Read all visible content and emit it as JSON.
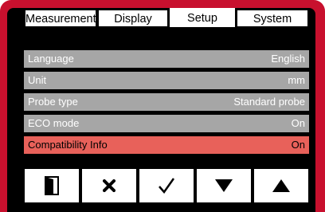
{
  "tabs": [
    {
      "label": "Measurement",
      "active": false
    },
    {
      "label": "Display",
      "active": false
    },
    {
      "label": "Setup",
      "active": true
    },
    {
      "label": "System",
      "active": false
    }
  ],
  "settings": [
    {
      "label": "Language",
      "value": "English"
    },
    {
      "label": "Unit",
      "value": "mm"
    },
    {
      "label": "Probe type",
      "value": "Standard probe"
    },
    {
      "label": "ECO mode",
      "value": "On"
    },
    {
      "label": "Compatibility Info",
      "value": "On",
      "selected": true
    }
  ],
  "softkeys": [
    {
      "icon": "exit-door-icon"
    },
    {
      "icon": "cancel-x-icon"
    },
    {
      "icon": "confirm-check-icon"
    },
    {
      "icon": "arrow-down-icon"
    },
    {
      "icon": "arrow-up-icon"
    }
  ],
  "colors": {
    "housing": "#c8102e",
    "screen": "#000000",
    "row_background": "#a6a6a6",
    "selected_row": "#e8615a"
  }
}
